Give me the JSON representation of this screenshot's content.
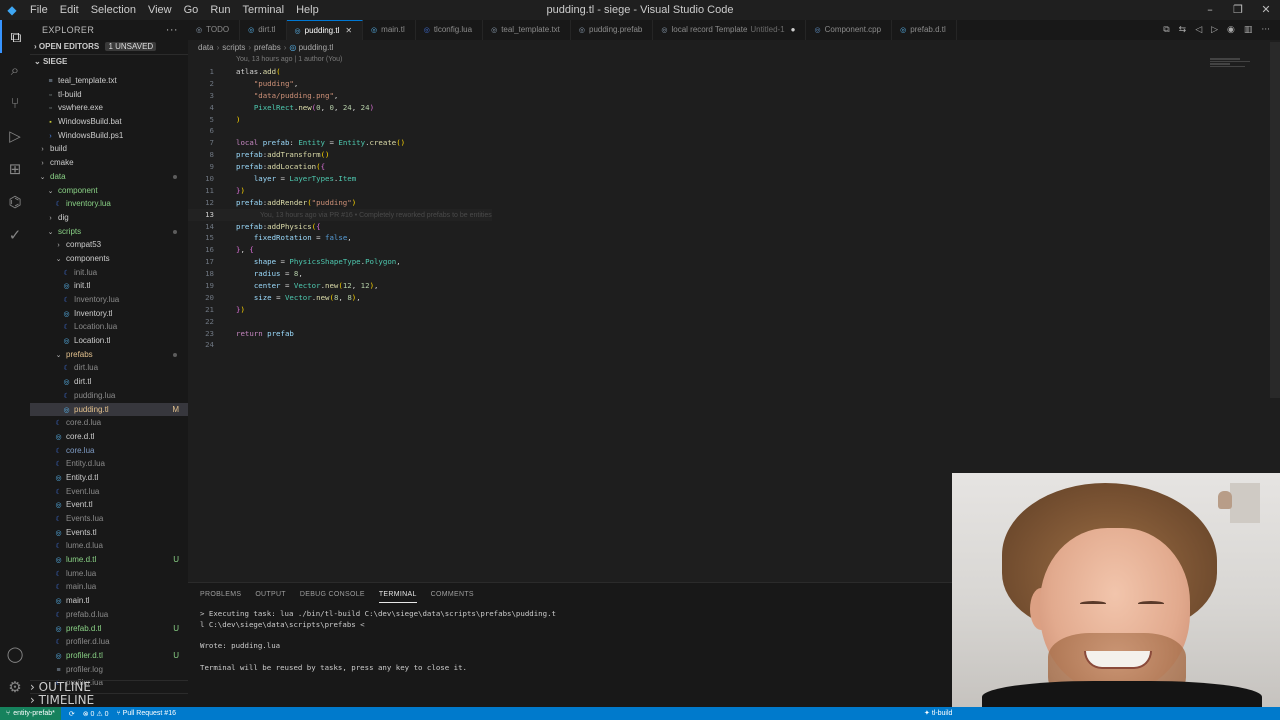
{
  "app": {
    "window_title": "pudding.tl - siege - Visual Studio Code",
    "menu": [
      "File",
      "Edit",
      "Selection",
      "View",
      "Go",
      "Run",
      "Terminal",
      "Help"
    ],
    "logo_icon": "vscode-logo-icon"
  },
  "sidebar": {
    "title": "EXPLORER",
    "open_editors": "OPEN EDITORS",
    "unsaved_badge": "1 UNSAVED",
    "project": "SIEGE",
    "outline": "OUTLINE",
    "timeline": "TIMELINE",
    "tree": [
      {
        "name": "teal_template.txt",
        "indent": 1,
        "kind": "txt"
      },
      {
        "name": "tl-build",
        "indent": 1,
        "kind": "exe"
      },
      {
        "name": "vswhere.exe",
        "indent": 1,
        "kind": "exe"
      },
      {
        "name": "WindowsBuild.bat",
        "indent": 1,
        "kind": "bat"
      },
      {
        "name": "WindowsBuild.ps1",
        "indent": 1,
        "kind": "ps"
      },
      {
        "name": "build",
        "indent": 0,
        "kind": "folder",
        "open": false
      },
      {
        "name": "cmake",
        "indent": 0,
        "kind": "folder",
        "open": false
      },
      {
        "name": "data",
        "indent": 0,
        "kind": "folder",
        "open": true,
        "color": "green",
        "dot": true
      },
      {
        "name": "component",
        "indent": 1,
        "kind": "folder",
        "open": true,
        "color": "green"
      },
      {
        "name": "inventory.lua",
        "indent": 2,
        "kind": "lua",
        "color": "green"
      },
      {
        "name": "dig",
        "indent": 1,
        "kind": "folder",
        "open": false
      },
      {
        "name": "scripts",
        "indent": 1,
        "kind": "folder",
        "open": true,
        "color": "green",
        "dot": true
      },
      {
        "name": "compat53",
        "indent": 2,
        "kind": "folder",
        "open": false
      },
      {
        "name": "components",
        "indent": 2,
        "kind": "folder",
        "open": true
      },
      {
        "name": "init.lua",
        "indent": 3,
        "kind": "lua",
        "color": "dim"
      },
      {
        "name": "init.tl",
        "indent": 3,
        "kind": "tl"
      },
      {
        "name": "Inventory.lua",
        "indent": 3,
        "kind": "lua",
        "color": "dim"
      },
      {
        "name": "Inventory.tl",
        "indent": 3,
        "kind": "tl"
      },
      {
        "name": "Location.lua",
        "indent": 3,
        "kind": "lua",
        "color": "dim"
      },
      {
        "name": "Location.tl",
        "indent": 3,
        "kind": "tl"
      },
      {
        "name": "prefabs",
        "indent": 2,
        "kind": "folder",
        "open": true,
        "color": "mod",
        "dot": true
      },
      {
        "name": "dirt.lua",
        "indent": 3,
        "kind": "lua",
        "color": "dim"
      },
      {
        "name": "dirt.tl",
        "indent": 3,
        "kind": "tl"
      },
      {
        "name": "pudding.lua",
        "indent": 3,
        "kind": "lua",
        "color": "dim"
      },
      {
        "name": "pudding.tl",
        "indent": 3,
        "kind": "tl",
        "color": "mod",
        "status": "M",
        "selected": true
      },
      {
        "name": "core.d.lua",
        "indent": 2,
        "kind": "lua",
        "color": "dim"
      },
      {
        "name": "core.d.tl",
        "indent": 2,
        "kind": "tl"
      },
      {
        "name": "core.lua",
        "indent": 2,
        "kind": "lua"
      },
      {
        "name": "Entity.d.lua",
        "indent": 2,
        "kind": "lua",
        "color": "dim"
      },
      {
        "name": "Entity.d.tl",
        "indent": 2,
        "kind": "tl"
      },
      {
        "name": "Event.lua",
        "indent": 2,
        "kind": "lua",
        "color": "dim"
      },
      {
        "name": "Event.tl",
        "indent": 2,
        "kind": "tl"
      },
      {
        "name": "Events.lua",
        "indent": 2,
        "kind": "lua",
        "color": "dim"
      },
      {
        "name": "Events.tl",
        "indent": 2,
        "kind": "tl"
      },
      {
        "name": "lume.d.lua",
        "indent": 2,
        "kind": "lua",
        "color": "dim"
      },
      {
        "name": "lume.d.tl",
        "indent": 2,
        "kind": "tl",
        "color": "green",
        "status": "U"
      },
      {
        "name": "lume.lua",
        "indent": 2,
        "kind": "lua",
        "color": "dim"
      },
      {
        "name": "main.lua",
        "indent": 2,
        "kind": "lua",
        "color": "dim"
      },
      {
        "name": "main.tl",
        "indent": 2,
        "kind": "tl"
      },
      {
        "name": "prefab.d.lua",
        "indent": 2,
        "kind": "lua",
        "color": "dim"
      },
      {
        "name": "prefab.d.tl",
        "indent": 2,
        "kind": "tl",
        "color": "green",
        "status": "U"
      },
      {
        "name": "profiler.d.lua",
        "indent": 2,
        "kind": "lua",
        "color": "dim"
      },
      {
        "name": "profiler.d.tl",
        "indent": 2,
        "kind": "tl",
        "color": "green",
        "status": "U"
      },
      {
        "name": "profiler.log",
        "indent": 2,
        "kind": "txt",
        "color": "dim"
      },
      {
        "name": "profiler.lua",
        "indent": 2,
        "kind": "lua",
        "color": "dim"
      }
    ]
  },
  "tabs": [
    {
      "label": "TODO",
      "icon": "todo-icon",
      "icon_color": "#8ea0b3"
    },
    {
      "label": "dirt.tl",
      "icon": "teal-file-icon",
      "icon_color": "#58b6ef"
    },
    {
      "label": "pudding.tl",
      "icon": "teal-file-icon",
      "icon_color": "#58b6ef",
      "active": true
    },
    {
      "label": "main.tl",
      "icon": "teal-file-icon",
      "icon_color": "#58b6ef"
    },
    {
      "label": "tlconfig.lua",
      "icon": "lua-file-icon",
      "icon_color": "#3f6fd8"
    },
    {
      "label": "teal_template.txt",
      "icon": "text-file-icon",
      "icon_color": "#8ea0b3"
    },
    {
      "label": "pudding.prefab",
      "icon": "prefab-file-icon",
      "icon_color": "#8ea0b3"
    },
    {
      "label": "local record Template",
      "sub": "Untitled-1",
      "icon": "untitled-file-icon",
      "icon_color": "#8ea0b3",
      "modified": true
    },
    {
      "label": "Component.cpp",
      "icon": "cpp-file-icon",
      "icon_color": "#6295cb"
    },
    {
      "label": "prefab.d.tl",
      "icon": "teal-file-icon",
      "icon_color": "#58b6ef"
    }
  ],
  "breadcrumb": [
    "data",
    "scripts",
    "prefabs",
    "pudding.tl"
  ],
  "editor": {
    "blame_header": "You, 13 hours ago | 1 author (You)",
    "ghost_blame": "You, 13 hours ago via PR #16 • Completely reworked prefabs to be entities",
    "current_line": 13,
    "lines": [
      [
        [
          "atlas",
          "id"
        ],
        [
          ".",
          "id"
        ],
        [
          "add",
          "fn"
        ],
        [
          "(",
          "br"
        ]
      ],
      [
        [
          "    ",
          ""
        ],
        [
          "\"pudding\"",
          "str"
        ],
        [
          ",",
          "id"
        ]
      ],
      [
        [
          "    ",
          ""
        ],
        [
          "\"data/pudding.png\"",
          "str"
        ],
        [
          ",",
          "id"
        ]
      ],
      [
        [
          "    ",
          ""
        ],
        [
          "PixelRect",
          "type"
        ],
        [
          ".",
          "id"
        ],
        [
          "new",
          "fn"
        ],
        [
          "(",
          "br2"
        ],
        [
          "0",
          "num"
        ],
        [
          ", ",
          "id"
        ],
        [
          "0",
          "num"
        ],
        [
          ", ",
          "id"
        ],
        [
          "24",
          "num"
        ],
        [
          ", ",
          "id"
        ],
        [
          "24",
          "num"
        ],
        [
          ")",
          "br2"
        ]
      ],
      [
        [
          ")",
          "br"
        ]
      ],
      [],
      [
        [
          "local ",
          "kw"
        ],
        [
          "prefab",
          "var"
        ],
        [
          ": ",
          "id"
        ],
        [
          "Entity",
          "type"
        ],
        [
          " = ",
          "id"
        ],
        [
          "Entity",
          "type"
        ],
        [
          ".",
          "id"
        ],
        [
          "create",
          "fn"
        ],
        [
          "()",
          "br"
        ]
      ],
      [
        [
          "prefab",
          "var"
        ],
        [
          ":",
          "id"
        ],
        [
          "addTransform",
          "fn"
        ],
        [
          "()",
          "br"
        ]
      ],
      [
        [
          "prefab",
          "var"
        ],
        [
          ":",
          "id"
        ],
        [
          "addLocation",
          "fn"
        ],
        [
          "(",
          "br"
        ],
        [
          "{",
          "br2"
        ]
      ],
      [
        [
          "    ",
          ""
        ],
        [
          "layer",
          "var"
        ],
        [
          " = ",
          "id"
        ],
        [
          "LayerTypes",
          "type"
        ],
        [
          ".",
          "id"
        ],
        [
          "Item",
          "type"
        ]
      ],
      [
        [
          "}",
          "br2"
        ],
        [
          ")",
          "br"
        ]
      ],
      [
        [
          "prefab",
          "var"
        ],
        [
          ":",
          "id"
        ],
        [
          "addRender",
          "fn"
        ],
        [
          "(",
          "br"
        ],
        [
          "\"pudding\"",
          "str"
        ],
        [
          ")",
          "br"
        ]
      ],
      [],
      [
        [
          "prefab",
          "var"
        ],
        [
          ":",
          "id"
        ],
        [
          "addPhysics",
          "fn"
        ],
        [
          "(",
          "br"
        ],
        [
          "{",
          "br2"
        ]
      ],
      [
        [
          "    ",
          ""
        ],
        [
          "fixedRotation",
          "var"
        ],
        [
          " = ",
          "id"
        ],
        [
          "false",
          "bool"
        ],
        [
          ",",
          "id"
        ]
      ],
      [
        [
          "}",
          "br2"
        ],
        [
          ", ",
          "id"
        ],
        [
          "{",
          "br2"
        ]
      ],
      [
        [
          "    ",
          ""
        ],
        [
          "shape",
          "var"
        ],
        [
          " = ",
          "id"
        ],
        [
          "PhysicsShapeType",
          "type"
        ],
        [
          ".",
          "id"
        ],
        [
          "Polygon",
          "type"
        ],
        [
          ",",
          "id"
        ]
      ],
      [
        [
          "    ",
          ""
        ],
        [
          "radius",
          "var"
        ],
        [
          " = ",
          "id"
        ],
        [
          "8",
          "num"
        ],
        [
          ",",
          "id"
        ]
      ],
      [
        [
          "    ",
          ""
        ],
        [
          "center",
          "var"
        ],
        [
          " = ",
          "id"
        ],
        [
          "Vector",
          "type"
        ],
        [
          ".",
          "id"
        ],
        [
          "new",
          "fn"
        ],
        [
          "(",
          "br"
        ],
        [
          "12",
          "num"
        ],
        [
          ", ",
          "id"
        ],
        [
          "12",
          "num"
        ],
        [
          ")",
          "br"
        ],
        [
          ",",
          "id"
        ]
      ],
      [
        [
          "    ",
          ""
        ],
        [
          "size",
          "var"
        ],
        [
          " = ",
          "id"
        ],
        [
          "Vector",
          "type"
        ],
        [
          ".",
          "id"
        ],
        [
          "new",
          "fn"
        ],
        [
          "(",
          "br"
        ],
        [
          "8",
          "num"
        ],
        [
          ", ",
          "id"
        ],
        [
          "8",
          "num"
        ],
        [
          ")",
          "br"
        ],
        [
          ",",
          "id"
        ]
      ],
      [
        [
          "}",
          "br2"
        ],
        [
          ")",
          "br"
        ]
      ],
      [],
      [
        [
          "return ",
          "kw"
        ],
        [
          "prefab",
          "var"
        ]
      ],
      []
    ]
  },
  "panel": {
    "tabs": [
      "PROBLEMS",
      "OUTPUT",
      "DEBUG CONSOLE",
      "TERMINAL",
      "COMMENTS"
    ],
    "active_tab": "TERMINAL",
    "terminal_lines": [
      "> Executing task: lua ./bin/tl-build C:\\dev\\siege\\data\\scripts\\prefabs\\pudding.t",
      "l C:\\dev\\siege\\data\\scripts\\prefabs <",
      "",
      "Wrote: pudding.lua",
      "",
      "Terminal will be reused by tasks, press any key to close it."
    ]
  },
  "statusbar": {
    "branch": "entity-prefab*",
    "errors": "0",
    "warnings": "0",
    "pull_request": "Pull Request #16",
    "task": "tl-build"
  },
  "colors": {
    "accent": "#007acc",
    "remote": "#16825d",
    "active_tab_border": "#0078d4"
  }
}
